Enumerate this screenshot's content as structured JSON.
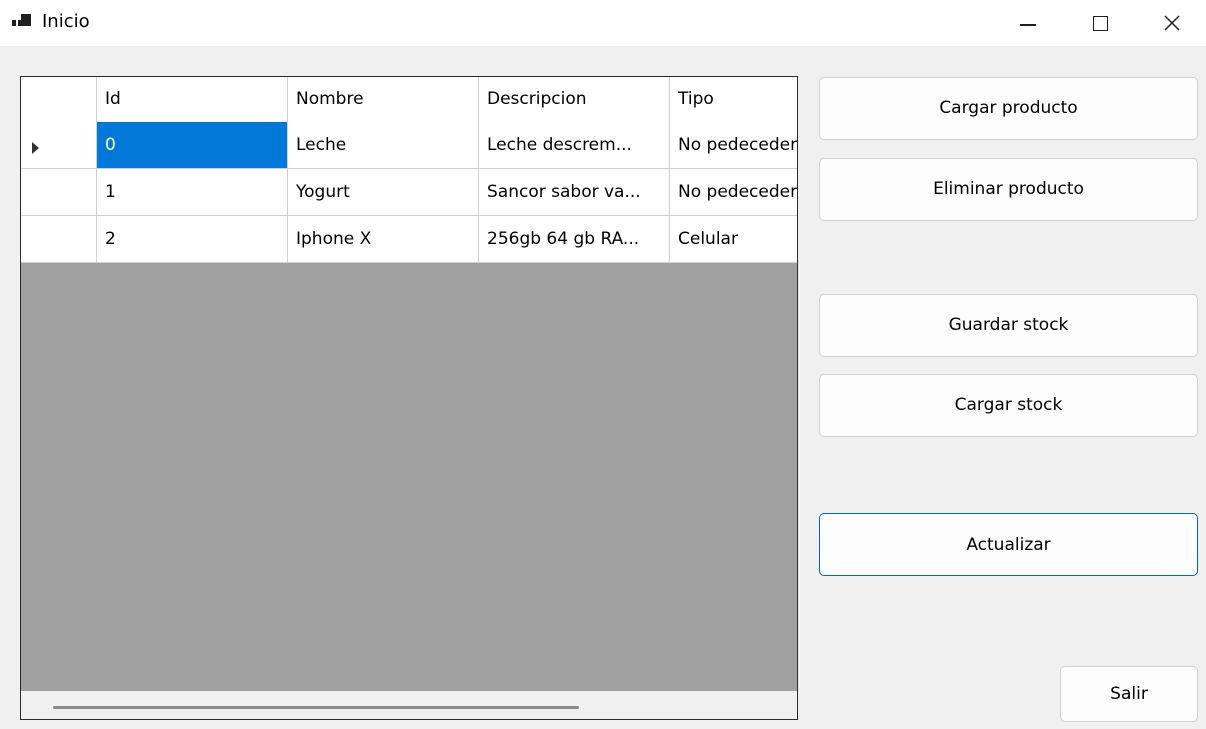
{
  "window": {
    "title": "Inicio"
  },
  "grid": {
    "columns": [
      "Id",
      "Nombre",
      "Descripcion",
      "Tipo"
    ],
    "rows": [
      {
        "id": "0",
        "nombre": "Leche",
        "descripcion": "Leche descrem...",
        "tipo": "No pedecedero"
      },
      {
        "id": "1",
        "nombre": "Yogurt",
        "descripcion": "Sancor sabor va...",
        "tipo": "No pedecedero"
      },
      {
        "id": "2",
        "nombre": "Iphone X",
        "descripcion": "256gb 64 gb RA...",
        "tipo": "Celular"
      }
    ],
    "selected_row": 0
  },
  "buttons": {
    "cargar_producto": "Cargar producto",
    "eliminar_producto": "Eliminar producto",
    "guardar_stock": "Guardar stock",
    "cargar_stock": "Cargar stock",
    "actualizar": "Actualizar",
    "salir": "Salir"
  },
  "colors": {
    "selection": "#0078d7",
    "grid_background": "#a0a0a0",
    "focus_border": "#0067c0"
  }
}
